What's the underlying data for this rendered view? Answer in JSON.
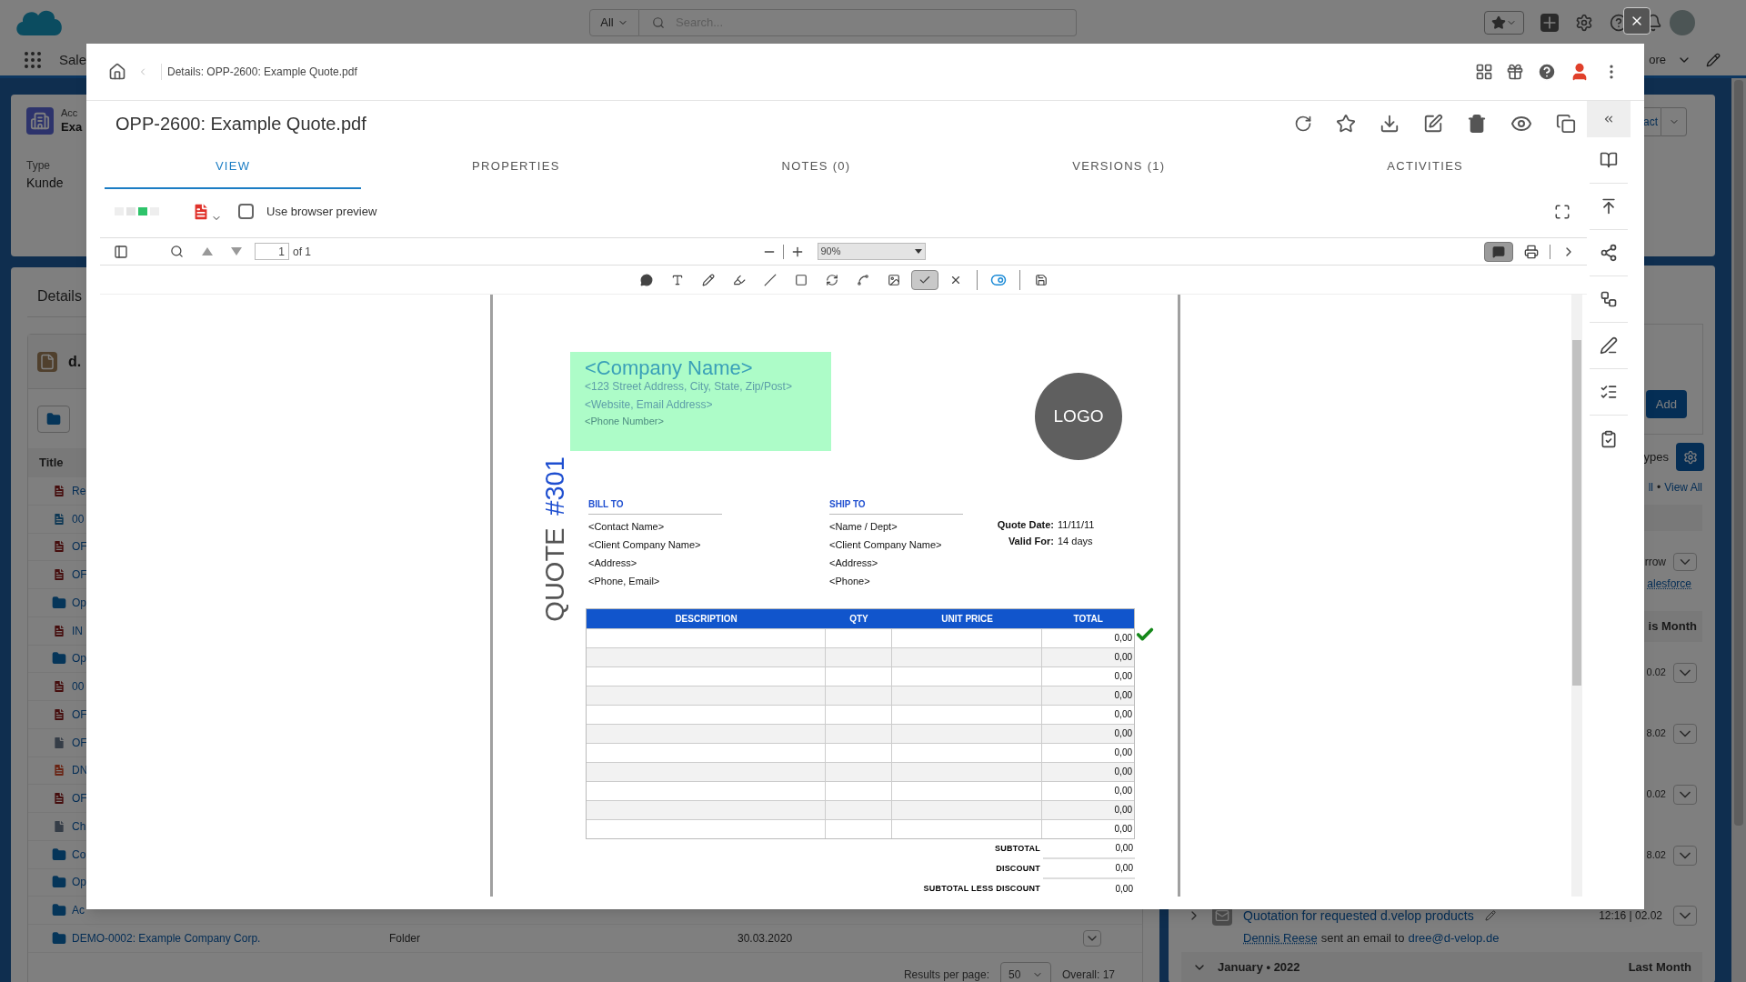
{
  "background": {
    "global_header": {
      "scope": "All",
      "search_placeholder": "Search..."
    },
    "nav": {
      "app_name": "Sale",
      "more": "ore"
    },
    "record_header": {
      "object_label": "Acc",
      "name": "Exa",
      "type_label": "Type",
      "type_value": "Kunde",
      "action": "act"
    },
    "details": {
      "tab": "Details",
      "card_title": "d.",
      "column_title": "Title",
      "rows": [
        {
          "name": "Re",
          "kind": "pdf"
        },
        {
          "name": "00",
          "kind": "doc"
        },
        {
          "name": "OF",
          "kind": "pdf"
        },
        {
          "name": "OF",
          "kind": "pdf"
        },
        {
          "name": "Op",
          "kind": "folder"
        },
        {
          "name": "IN",
          "kind": "pdf"
        },
        {
          "name": "Op",
          "kind": "folder"
        },
        {
          "name": "00",
          "kind": "pdf"
        },
        {
          "name": "OF",
          "kind": "pdf"
        },
        {
          "name": "OF",
          "kind": "edit"
        },
        {
          "name": "DN",
          "kind": "ppt"
        },
        {
          "name": "OF",
          "kind": "pdf"
        },
        {
          "name": "Ch",
          "kind": "edit"
        },
        {
          "name": "Co",
          "kind": "folder"
        },
        {
          "name": "Op",
          "kind": "folder"
        },
        {
          "name": "Ac",
          "kind": "folder"
        },
        {
          "name": "DEMO-0002: Example Company Corp.",
          "kind": "folder",
          "type": "Folder",
          "date": "30.03.2020"
        }
      ],
      "footer": {
        "results_label": "Results per page:",
        "per_page": "50",
        "overall": "Overall: 17"
      }
    },
    "activity": {
      "add": "Add",
      "types": "ypes",
      "link_all": "ll",
      "separator": "•",
      "view_all": "View All",
      "filter": "rrow",
      "link": "alesforce",
      "month_header": "is Month",
      "dates": [
        "0.02",
        "8.02",
        "0.02",
        "8.02"
      ],
      "item": {
        "title": "Quotation for requested d.velop products",
        "time": "12:16 | 02.02",
        "actor": "Dennis Reese",
        "text": "sent an email to",
        "email": "dree@d-velop.de"
      },
      "next_group": {
        "title": "January • 2022",
        "label": "Last Month"
      }
    }
  },
  "modal": {
    "breadcrumb": "Details: OPP-2600: Example Quote.pdf",
    "title": "OPP-2600: Example Quote.pdf",
    "tabs": [
      {
        "label": "VIEW",
        "selected": true
      },
      {
        "label": "PROPERTIES",
        "selected": false
      },
      {
        "label": "NOTES (0)",
        "selected": false
      },
      {
        "label": "VERSIONS (1)",
        "selected": false
      },
      {
        "label": "ACTIVITIES",
        "selected": false
      }
    ],
    "browser_preview": {
      "label": "Use browser preview",
      "checked": false
    },
    "viewer": {
      "page": "1",
      "page_count": "of 1",
      "zoom": "90%",
      "comments_on": true
    },
    "annotation_tool_groups": [
      {
        "tools": [
          {
            "kind": "comment",
            "selected": false
          },
          {
            "kind": "text",
            "selected": false
          },
          {
            "kind": "pencil",
            "selected": false
          },
          {
            "kind": "marker",
            "selected": false
          },
          {
            "kind": "line",
            "selected": false
          },
          {
            "kind": "rectangle",
            "selected": false
          },
          {
            "kind": "ellipse",
            "selected": false
          },
          {
            "kind": "polyline",
            "selected": false
          },
          {
            "kind": "image",
            "selected": false
          },
          {
            "kind": "check",
            "selected": true
          },
          {
            "kind": "cross",
            "selected": false
          }
        ]
      },
      {
        "tools": [
          {
            "kind": "toggle",
            "selected": false
          }
        ]
      },
      {
        "tools": [
          {
            "kind": "save",
            "selected": false
          }
        ]
      }
    ],
    "document": {
      "company": {
        "name": "<Company Name>",
        "address": "<123 Street Address, City, State, Zip/Post>",
        "web": "<Website, Email Address>",
        "phone": "<Phone Number>"
      },
      "logo": "LOGO",
      "quote_label": "QUOTE",
      "quote_number": "#301",
      "bill_to": {
        "heading": "BILL TO",
        "lines": [
          "<Contact Name>",
          "<Client Company Name>",
          "<Address>",
          "<Phone, Email>"
        ]
      },
      "ship_to": {
        "heading": "SHIP TO",
        "lines": [
          "<Name / Dept>",
          "<Client Company Name>",
          "<Address>",
          "<Phone>"
        ]
      },
      "meta": [
        {
          "label": "Quote Date:",
          "value": "11/11/11"
        },
        {
          "label": "Valid For:",
          "value": "14 days"
        }
      ],
      "table": {
        "columns": [
          "DESCRIPTION",
          "QTY",
          "UNIT PRICE",
          "TOTAL"
        ],
        "rows": [
          {
            "total": "0,00"
          },
          {
            "total": "0,00"
          },
          {
            "total": "0,00"
          },
          {
            "total": "0,00"
          },
          {
            "total": "0,00"
          },
          {
            "total": "0,00"
          },
          {
            "total": "0,00"
          },
          {
            "total": "0,00"
          },
          {
            "total": "0,00"
          },
          {
            "total": "0,00"
          },
          {
            "total": "0,00"
          }
        ]
      },
      "totals": [
        {
          "label": "SUBTOTAL",
          "value": "0,00"
        },
        {
          "label": "DISCOUNT",
          "value": "0,00"
        },
        {
          "label": "SUBTOTAL LESS DISCOUNT",
          "value": "0,00"
        }
      ]
    }
  }
}
